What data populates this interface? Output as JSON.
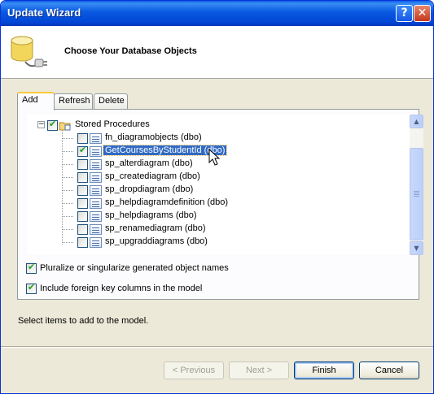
{
  "window": {
    "title": "Update Wizard"
  },
  "titlebar_buttons": {
    "help": "?",
    "close": "✕"
  },
  "header": {
    "title": "Choose Your Database Objects",
    "icon": "database-plug-icon"
  },
  "tabs": [
    {
      "label": "Add",
      "active": true
    },
    {
      "label": "Refresh",
      "active": false
    },
    {
      "label": "Delete",
      "active": false
    }
  ],
  "tree": {
    "root": {
      "label": "Stored Procedures",
      "checked": true,
      "expander": "−"
    },
    "items": [
      {
        "label": "fn_diagramobjects (dbo)",
        "checked": false,
        "selected": false
      },
      {
        "label": "GetCoursesByStudentId (dbo)",
        "checked": true,
        "selected": true
      },
      {
        "label": "sp_alterdiagram (dbo)",
        "checked": false,
        "selected": false
      },
      {
        "label": "sp_creatediagram (dbo)",
        "checked": false,
        "selected": false
      },
      {
        "label": "sp_dropdiagram (dbo)",
        "checked": false,
        "selected": false
      },
      {
        "label": "sp_helpdiagramdefinition (dbo)",
        "checked": false,
        "selected": false
      },
      {
        "label": "sp_helpdiagrams (dbo)",
        "checked": false,
        "selected": false
      },
      {
        "label": "sp_renamediagram (dbo)",
        "checked": false,
        "selected": false
      },
      {
        "label": "sp_upgraddiagrams (dbo)",
        "checked": false,
        "selected": false
      }
    ]
  },
  "options": [
    {
      "label": "Pluralize or singularize generated object names",
      "checked": true
    },
    {
      "label": "Include foreign key columns in the model",
      "checked": true
    }
  ],
  "status_text": "Select items to add to the model.",
  "buttons": {
    "previous": "< Previous",
    "next": "Next >",
    "finish": "Finish",
    "cancel": "Cancel"
  }
}
